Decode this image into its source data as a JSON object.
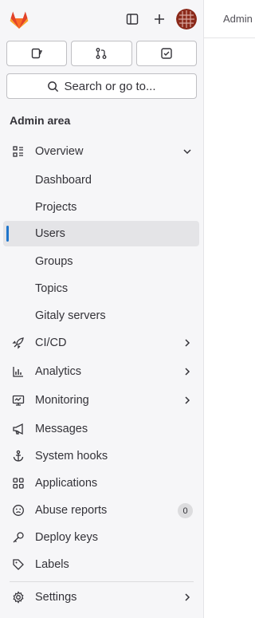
{
  "header": {
    "logo_icon": "gitlab-logo",
    "toggle_sidebar_icon": "sidebar-toggle-icon",
    "new_icon": "plus-icon",
    "avatar_icon": "user-avatar"
  },
  "quick_actions": [
    {
      "name": "issues-icon"
    },
    {
      "name": "merge-requests-icon"
    },
    {
      "name": "todos-icon"
    }
  ],
  "search": {
    "label": "Search or go to..."
  },
  "nav": {
    "title": "Admin area",
    "items": [
      {
        "label": "Overview",
        "icon": "overview-icon",
        "expanded": true
      },
      {
        "label": "Dashboard",
        "sub": true
      },
      {
        "label": "Projects",
        "sub": true
      },
      {
        "label": "Users",
        "sub": true,
        "active": true
      },
      {
        "label": "Groups",
        "sub": true
      },
      {
        "label": "Topics",
        "sub": true
      },
      {
        "label": "Gitaly servers",
        "sub": true
      },
      {
        "label": "CI/CD",
        "icon": "rocket-icon",
        "chevron": true
      },
      {
        "label": "Analytics",
        "icon": "chart-icon",
        "chevron": true
      },
      {
        "label": "Monitoring",
        "icon": "monitor-icon",
        "chevron": true
      },
      {
        "label": "Messages",
        "icon": "bullhorn-icon"
      },
      {
        "label": "System hooks",
        "icon": "anchor-icon"
      },
      {
        "label": "Applications",
        "icon": "applications-icon"
      },
      {
        "label": "Abuse reports",
        "icon": "abuse-icon",
        "badge": "0"
      },
      {
        "label": "Deploy keys",
        "icon": "key-icon"
      },
      {
        "label": "Labels",
        "icon": "label-icon"
      },
      {
        "label": "Settings",
        "icon": "settings-icon",
        "chevron": true
      }
    ]
  },
  "main": {
    "breadcrumb": "Admin"
  }
}
